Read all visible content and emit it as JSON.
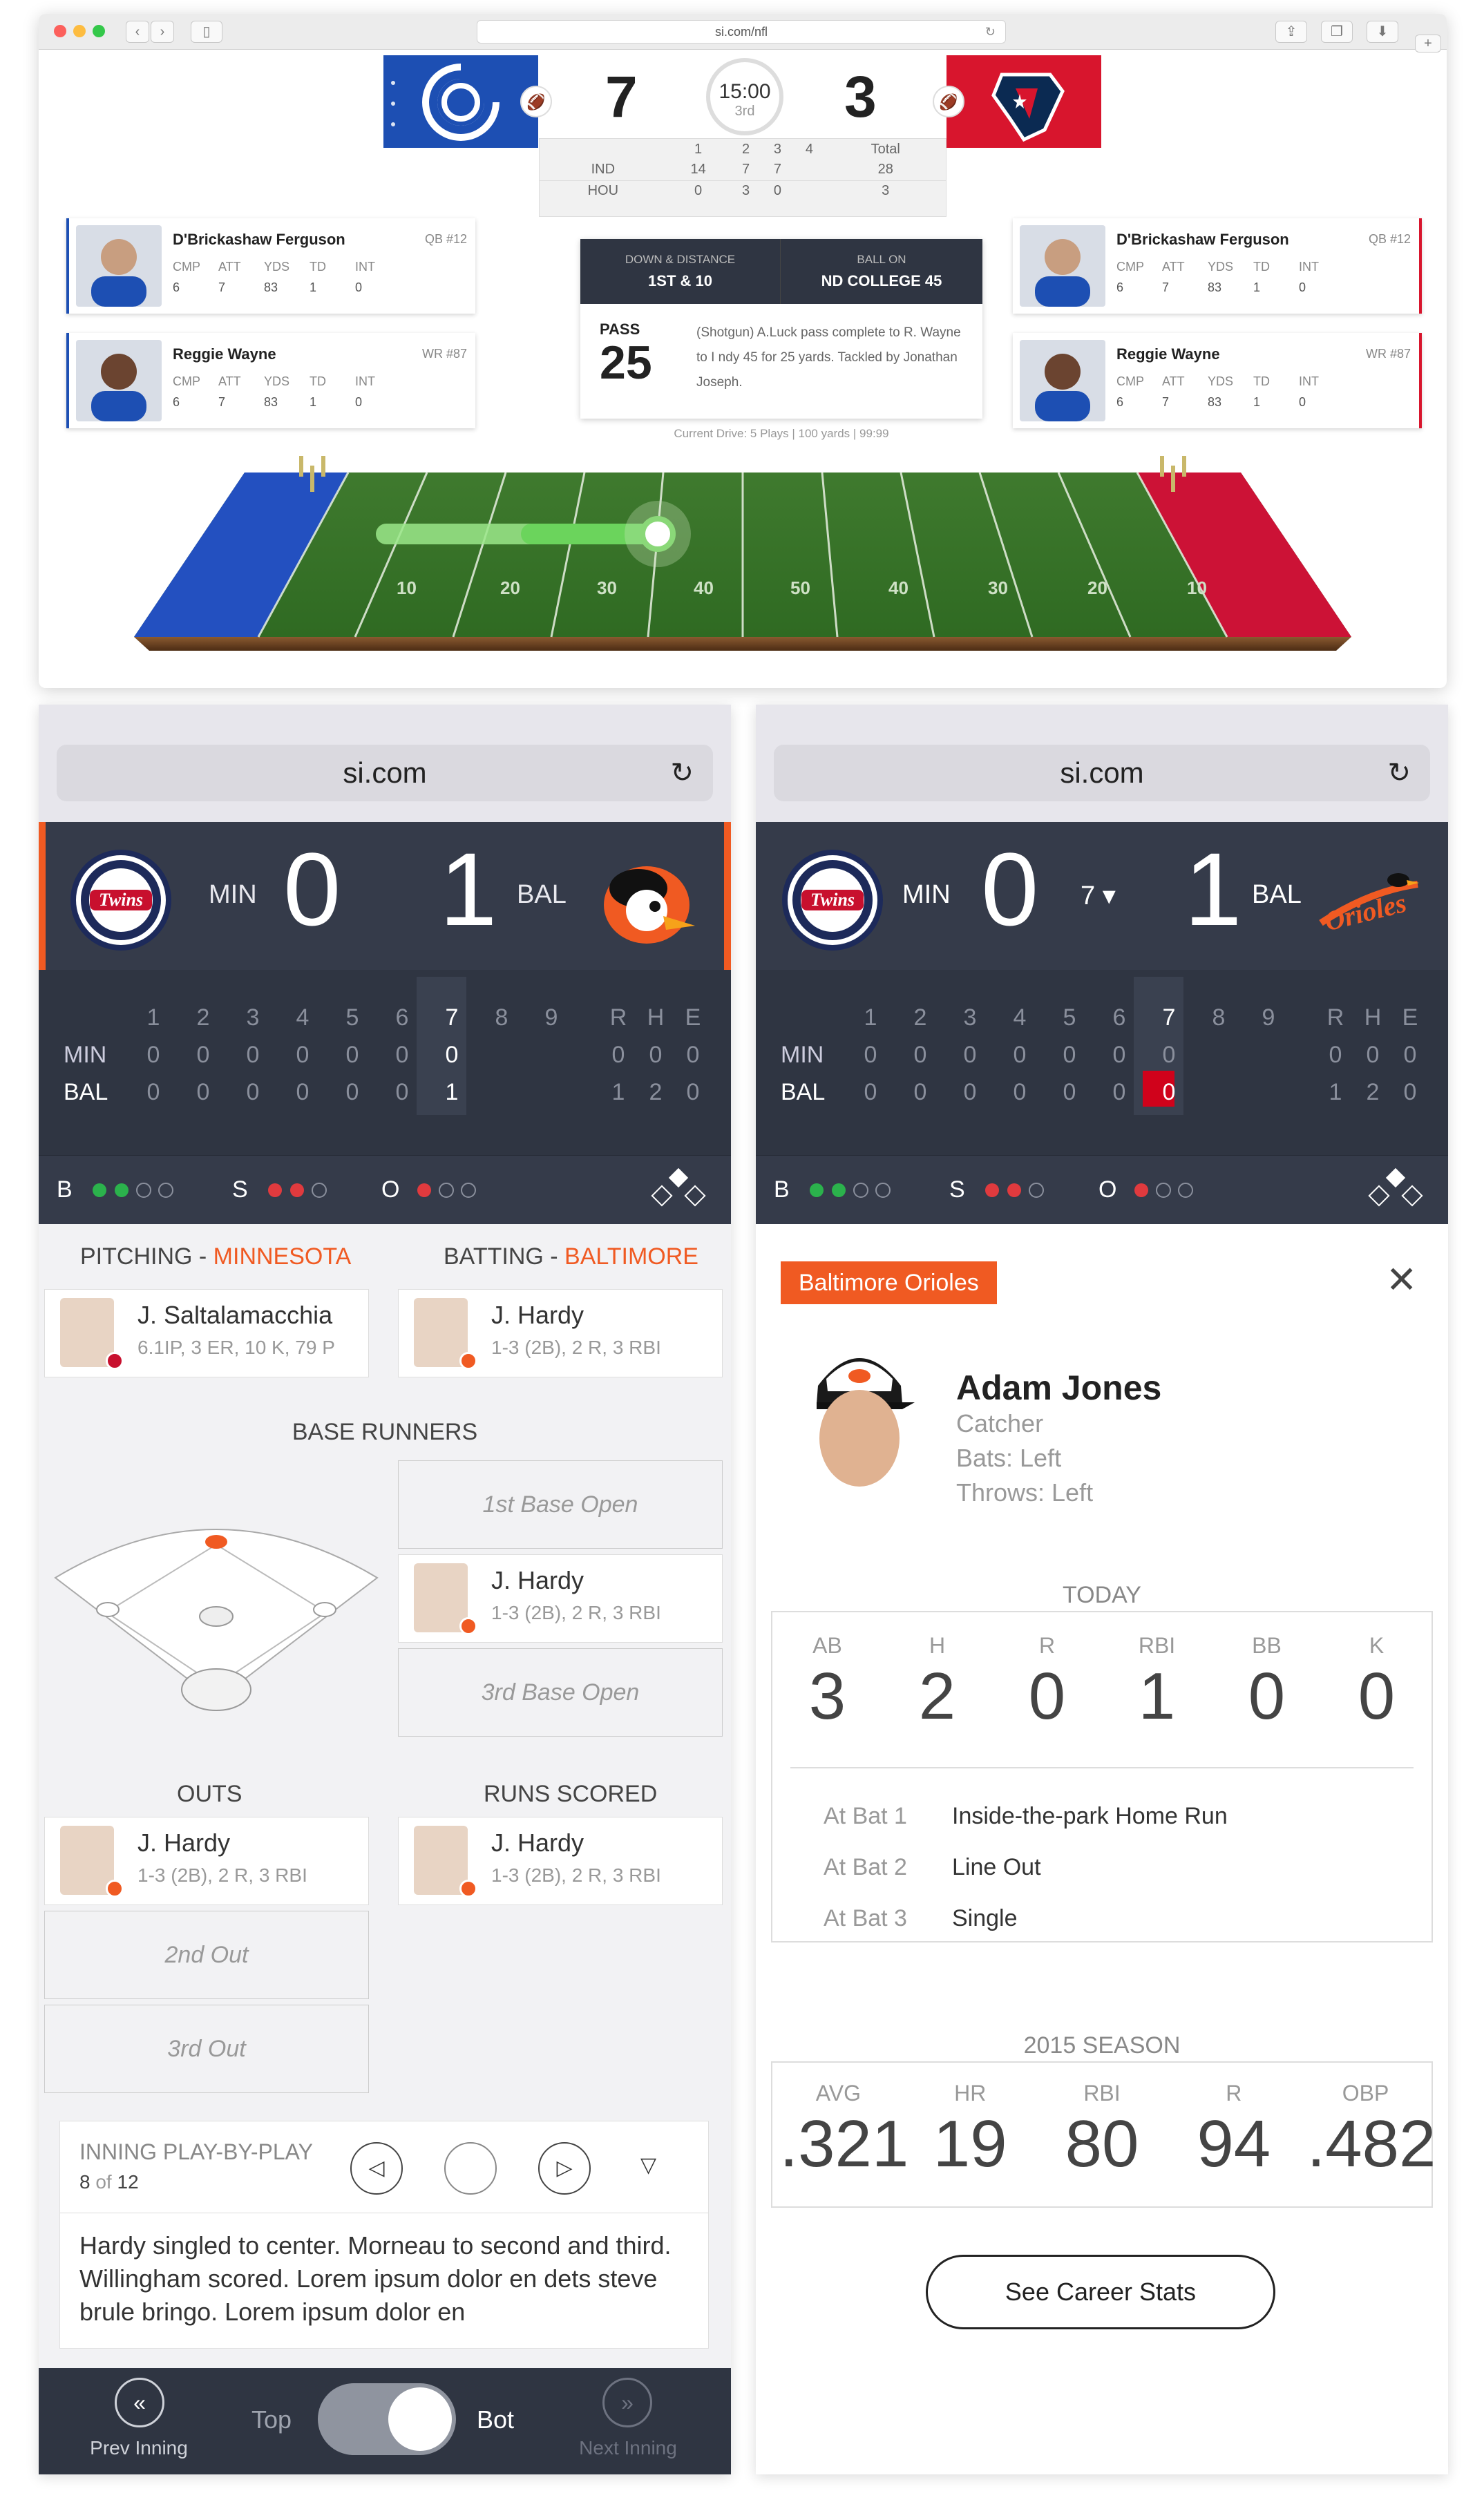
{
  "nfl": {
    "url": "si.com/nfl",
    "home_score": "7",
    "away_score": "3",
    "clock": "15:00",
    "quarter": "3rd",
    "linescore": {
      "headers": [
        "",
        "1",
        "2",
        "3",
        "4",
        "Total"
      ],
      "rows": [
        [
          "IND",
          "14",
          "7",
          "7",
          "",
          "28"
        ],
        [
          "HOU",
          "0",
          "3",
          "0",
          "",
          "3"
        ]
      ]
    },
    "players_left": [
      {
        "name": "D'Brickashaw Ferguson",
        "pos": "QB #12",
        "headers": [
          "CMP",
          "ATT",
          "YDS",
          "TD",
          "INT"
        ],
        "values": [
          "6",
          "7",
          "83",
          "1",
          "0"
        ]
      },
      {
        "name": "Reggie Wayne",
        "pos": "WR #87",
        "headers": [
          "CMP",
          "ATT",
          "YDS",
          "TD",
          "INT"
        ],
        "values": [
          "6",
          "7",
          "83",
          "1",
          "0"
        ]
      }
    ],
    "players_right": [
      {
        "name": "D'Brickashaw Ferguson",
        "pos": "QB #12",
        "headers": [
          "CMP",
          "ATT",
          "YDS",
          "TD",
          "INT"
        ],
        "values": [
          "6",
          "7",
          "83",
          "1",
          "0"
        ]
      },
      {
        "name": "Reggie Wayne",
        "pos": "WR #87",
        "headers": [
          "CMP",
          "ATT",
          "YDS",
          "TD",
          "INT"
        ],
        "values": [
          "6",
          "7",
          "83",
          "1",
          "0"
        ]
      }
    ],
    "drive": {
      "down_label": "DOWN & DISTANCE",
      "down_value": "1ST & 10",
      "ball_label": "BALL ON",
      "ball_value": "ND COLLEGE 45",
      "play_type": "PASS",
      "play_yards": "25",
      "play_desc": "(Shotgun) A.Luck pass complete to R. Wayne to I ndy 45 for 25 yards. Tackled by Jonathan Joseph.",
      "current_drive": "Current Drive: 5 Plays  |  100 yards  |  99:99"
    },
    "field_numbers": [
      "10",
      "20",
      "30",
      "40",
      "50",
      "40",
      "30",
      "20",
      "10"
    ]
  },
  "left": {
    "url": "si.com",
    "away_abbr": "MIN",
    "away_score": "0",
    "home_abbr": "BAL",
    "home_score": "1",
    "innings": [
      "1",
      "2",
      "3",
      "4",
      "5",
      "6",
      "7",
      "8",
      "9"
    ],
    "rhe": [
      "R",
      "H",
      "E"
    ],
    "rows": [
      {
        "team": "MIN",
        "cells": [
          "0",
          "0",
          "0",
          "0",
          "0",
          "0",
          "0",
          "",
          ""
        ],
        "rhe": [
          "0",
          "0",
          "0"
        ]
      },
      {
        "team": "BAL",
        "cells": [
          "0",
          "0",
          "0",
          "0",
          "0",
          "0",
          "1",
          "",
          ""
        ],
        "rhe": [
          "1",
          "2",
          "0"
        ]
      }
    ],
    "count": {
      "b": "B",
      "s": "S",
      "o": "O"
    },
    "pitching_label": "PITCHING - ",
    "pitching_team": "MINNESOTA",
    "batting_label": "BATTING - ",
    "batting_team": "BALTIMORE",
    "pitcher": {
      "name": "J. Saltalamacchia",
      "stats": "6.1IP, 3 ER, 10 K, 79 P"
    },
    "batter": {
      "name": "J. Hardy",
      "stats": "1-3 (2B), 2 R, 3 RBI"
    },
    "base_runners_title": "BASE RUNNERS",
    "first_base": "1st Base Open",
    "second_base": {
      "name": "J. Hardy",
      "stats": "1-3 (2B), 2 R, 3 RBI"
    },
    "third_base": "3rd Base Open",
    "outs_title": "OUTS",
    "runs_title": "RUNS SCORED",
    "out1": {
      "name": "J. Hardy",
      "stats": "1-3 (2B), 2 R, 3 RBI"
    },
    "out2": "2nd Out",
    "out3": "3rd Out",
    "run1": {
      "name": "J. Hardy",
      "stats": "1-3 (2B), 2 R, 3 RBI"
    },
    "pbp_title": "INNING PLAY-BY-PLAY",
    "pbp_page": "8",
    "pbp_of": " of ",
    "pbp_total": "12",
    "pbp_text": "Hardy singled to center. Morneau to second and third. Willingham scored. Lorem ipsum dolor en dets steve brule bringo. Lorem ipsum dolor en",
    "prev_inning": "Prev Inning",
    "next_inning": "Next Inning",
    "toggle_top": "Top",
    "toggle_bot": "Bot"
  },
  "right": {
    "url": "si.com",
    "away_abbr": "MIN",
    "away_score": "0",
    "inning_select": "7",
    "home_abbr": "BAL",
    "home_score": "1",
    "innings": [
      "1",
      "2",
      "3",
      "4",
      "5",
      "6",
      "7",
      "8",
      "9"
    ],
    "rhe": [
      "R",
      "H",
      "E"
    ],
    "rows": [
      {
        "team": "MIN",
        "cells": [
          "0",
          "0",
          "0",
          "0",
          "0",
          "0",
          "0",
          "",
          ""
        ],
        "rhe": [
          "0",
          "0",
          "0"
        ]
      },
      {
        "team": "BAL",
        "cells": [
          "0",
          "0",
          "0",
          "0",
          "0",
          "0",
          "0",
          "",
          ""
        ],
        "rhe": [
          "1",
          "2",
          "0"
        ]
      }
    ],
    "count": {
      "b": "B",
      "s": "S",
      "o": "O"
    },
    "team_badge": "Baltimore Orioles",
    "player": {
      "name": "Adam Jones",
      "position": "Catcher",
      "bats": "Bats: Left",
      "throws": "Throws: Left"
    },
    "today_title": "TODAY",
    "today_stats": [
      {
        "label": "AB",
        "value": "3"
      },
      {
        "label": "H",
        "value": "2"
      },
      {
        "label": "R",
        "value": "0"
      },
      {
        "label": "RBI",
        "value": "1"
      },
      {
        "label": "BB",
        "value": "0"
      },
      {
        "label": "K",
        "value": "0"
      }
    ],
    "at_bats": [
      {
        "label": "At Bat 1",
        "result": "Inside-the-park Home Run"
      },
      {
        "label": "At Bat 2",
        "result": "Line Out"
      },
      {
        "label": "At Bat 3",
        "result": "Single"
      }
    ],
    "season_title": "2015 SEASON",
    "season_stats": [
      {
        "label": "AVG",
        "value": ".321"
      },
      {
        "label": "HR",
        "value": "19"
      },
      {
        "label": "RBI",
        "value": "80"
      },
      {
        "label": "R",
        "value": "94"
      },
      {
        "label": "OBP",
        "value": ".482"
      }
    ],
    "career_button": "See Career Stats"
  },
  "colors": {
    "orioles_orange": "#f05a22",
    "board_dark": "#2f3542",
    "colts_blue": "#1d4fb3",
    "texans_red": "#d8152d"
  }
}
